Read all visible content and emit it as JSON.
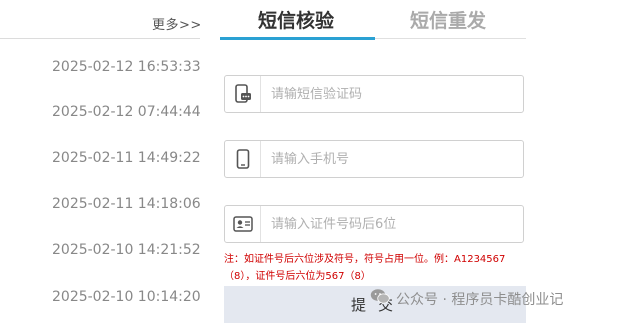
{
  "history": {
    "more_label": "更多>>",
    "times": [
      "2025-02-12 16:53:33",
      "2025-02-12 07:44:44",
      "2025-02-11 14:49:22",
      "2025-02-11 14:18:06",
      "2025-02-10 14:21:52",
      "2025-02-10 10:14:20"
    ]
  },
  "tabs": [
    {
      "label": "短信核验",
      "active": true
    },
    {
      "label": "短信重发",
      "active": false
    }
  ],
  "form": {
    "sms_code_placeholder": "请输短信验证码",
    "phone_placeholder": "请输入手机号",
    "id_placeholder": "请输入证件号码后6位",
    "note_line1": "注：如证件号后六位涉及符号，符号占用一位。例：A1234567",
    "note_line2": "（8），证件号后六位为567（8）",
    "submit_label": "提交"
  },
  "watermark": {
    "text": "公众号 · 程序员卡酷创业记"
  },
  "colors": {
    "accent": "#2aa1d3",
    "note": "#d00000",
    "button_bg": "#e4e8f0"
  },
  "icons": [
    "sms-phone-icon",
    "mobile-phone-icon",
    "id-card-icon",
    "wechat-icon"
  ]
}
